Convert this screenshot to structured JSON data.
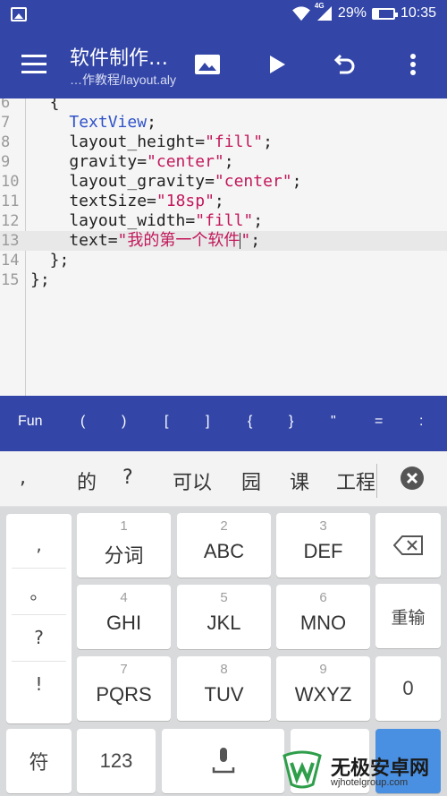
{
  "status_bar": {
    "network": "4G",
    "battery_text": "29%",
    "battery_level": 0.29,
    "time": "10:35"
  },
  "app_bar": {
    "title": "软件制作…",
    "subtitle": "…作教程/layout.aly",
    "icons": [
      "menu-icon",
      "image-icon",
      "play-icon",
      "undo-icon",
      "more-vert-icon"
    ]
  },
  "editor": {
    "lines": [
      {
        "num": "6",
        "tokens": [
          {
            "t": "  {",
            "c": "p"
          }
        ]
      },
      {
        "num": "7",
        "tokens": [
          {
            "t": "    ",
            "c": "p"
          },
          {
            "t": "TextView",
            "c": "kw"
          },
          {
            "t": ";",
            "c": "p"
          }
        ]
      },
      {
        "num": "8",
        "tokens": [
          {
            "t": "    layout_height=",
            "c": "p"
          },
          {
            "t": "\"fill\"",
            "c": "str"
          },
          {
            "t": ";",
            "c": "p"
          }
        ]
      },
      {
        "num": "9",
        "tokens": [
          {
            "t": "    gravity=",
            "c": "p"
          },
          {
            "t": "\"center\"",
            "c": "str"
          },
          {
            "t": ";",
            "c": "p"
          }
        ]
      },
      {
        "num": "10",
        "tokens": [
          {
            "t": "    layout_gravity=",
            "c": "p"
          },
          {
            "t": "\"center\"",
            "c": "str"
          },
          {
            "t": ";",
            "c": "p"
          }
        ]
      },
      {
        "num": "11",
        "tokens": [
          {
            "t": "    textSize=",
            "c": "p"
          },
          {
            "t": "\"18sp\"",
            "c": "str"
          },
          {
            "t": ";",
            "c": "p"
          }
        ]
      },
      {
        "num": "12",
        "tokens": [
          {
            "t": "    layout_width=",
            "c": "p"
          },
          {
            "t": "\"fill\"",
            "c": "str"
          },
          {
            "t": ";",
            "c": "p"
          }
        ]
      },
      {
        "num": "13",
        "active": true,
        "tokens": [
          {
            "t": "    text=",
            "c": "p"
          },
          {
            "t": "\"我的第一个软件",
            "c": "str"
          },
          {
            "t": "|",
            "c": "cursor"
          },
          {
            "t": "\"",
            "c": "str"
          },
          {
            "t": ";",
            "c": "p"
          }
        ]
      },
      {
        "num": "14",
        "tokens": [
          {
            "t": "  };",
            "c": "p"
          }
        ]
      },
      {
        "num": "15",
        "tokens": [
          {
            "t": "};",
            "c": "p"
          }
        ]
      }
    ]
  },
  "symbol_bar": [
    "Fun",
    "(",
    ")",
    "[",
    "]",
    "{",
    "}",
    "\"",
    "=",
    ":"
  ],
  "candidates": [
    ",",
    "的",
    "?",
    "可以",
    "园",
    "课",
    "工程"
  ],
  "keyboard": {
    "punct_column": [
      ",",
      "。",
      "?",
      "!"
    ],
    "keys": [
      {
        "num": "1",
        "label": "分词"
      },
      {
        "num": "2",
        "label": "ABC"
      },
      {
        "num": "3",
        "label": "DEF"
      },
      {
        "num": "4",
        "label": "GHI"
      },
      {
        "num": "5",
        "label": "JKL"
      },
      {
        "num": "6",
        "label": "MNO"
      },
      {
        "num": "7",
        "label": "PQRS"
      },
      {
        "num": "8",
        "label": "TUV"
      },
      {
        "num": "9",
        "label": "WXYZ"
      }
    ],
    "enter_label": "重输",
    "zero_label": "0",
    "symbol_label": "符",
    "numeric_label": "123"
  },
  "watermark": {
    "title": "无极安卓网",
    "url": "wjhotelgroup.com"
  }
}
